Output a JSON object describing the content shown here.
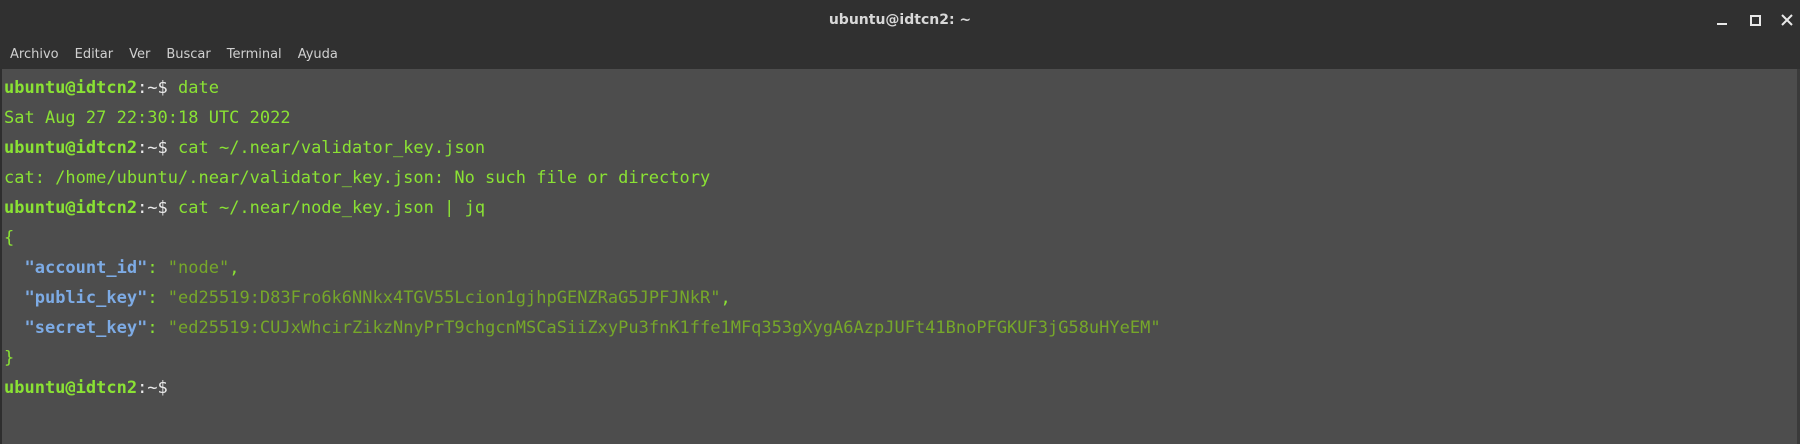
{
  "window": {
    "title": "ubuntu@idtcn2: ~",
    "controls": [
      "minimize-icon",
      "maximize-icon",
      "close-icon"
    ]
  },
  "menu": [
    "Archivo",
    "Editar",
    "Ver",
    "Buscar",
    "Terminal",
    "Ayuda"
  ],
  "prompt": {
    "user_host": "ubuntu@idtcn2",
    "suffix": ":~$ "
  },
  "lines": {
    "cmd1": "date",
    "out1": "Sat Aug 27 22:30:18 UTC 2022",
    "cmd2": "cat ~/.near/validator_key.json",
    "out2": "cat: /home/ubuntu/.near/validator_key.json: No such file or directory",
    "cmd3": "cat ~/.near/node_key.json | jq",
    "open_brace": "{",
    "close_brace": "}"
  },
  "json_output": [
    {
      "key": "\"account_id\"",
      "value": "\"node\"",
      "trail": ","
    },
    {
      "key": "\"public_key\"",
      "value": "\"ed25519:D83Fro6k6NNkx4TGV55Lcion1gjhpGENZRaG5JPFJNkR\"",
      "trail": ","
    },
    {
      "key": "\"secret_key\"",
      "value": "\"ed25519:CUJxWhcirZikzNnyPrT9chgcnMSCaSiiZxyPu3fnK1ffe1MFq353gXygA6AzpJUFt41BnoPFGKUF3jG58uHYeEM\"",
      "trail": ""
    }
  ],
  "colors": {
    "background": "#4d4d4d",
    "prompt_green": "#8ae234",
    "json_key": "#7dabe5",
    "json_string": "#76a72a"
  }
}
